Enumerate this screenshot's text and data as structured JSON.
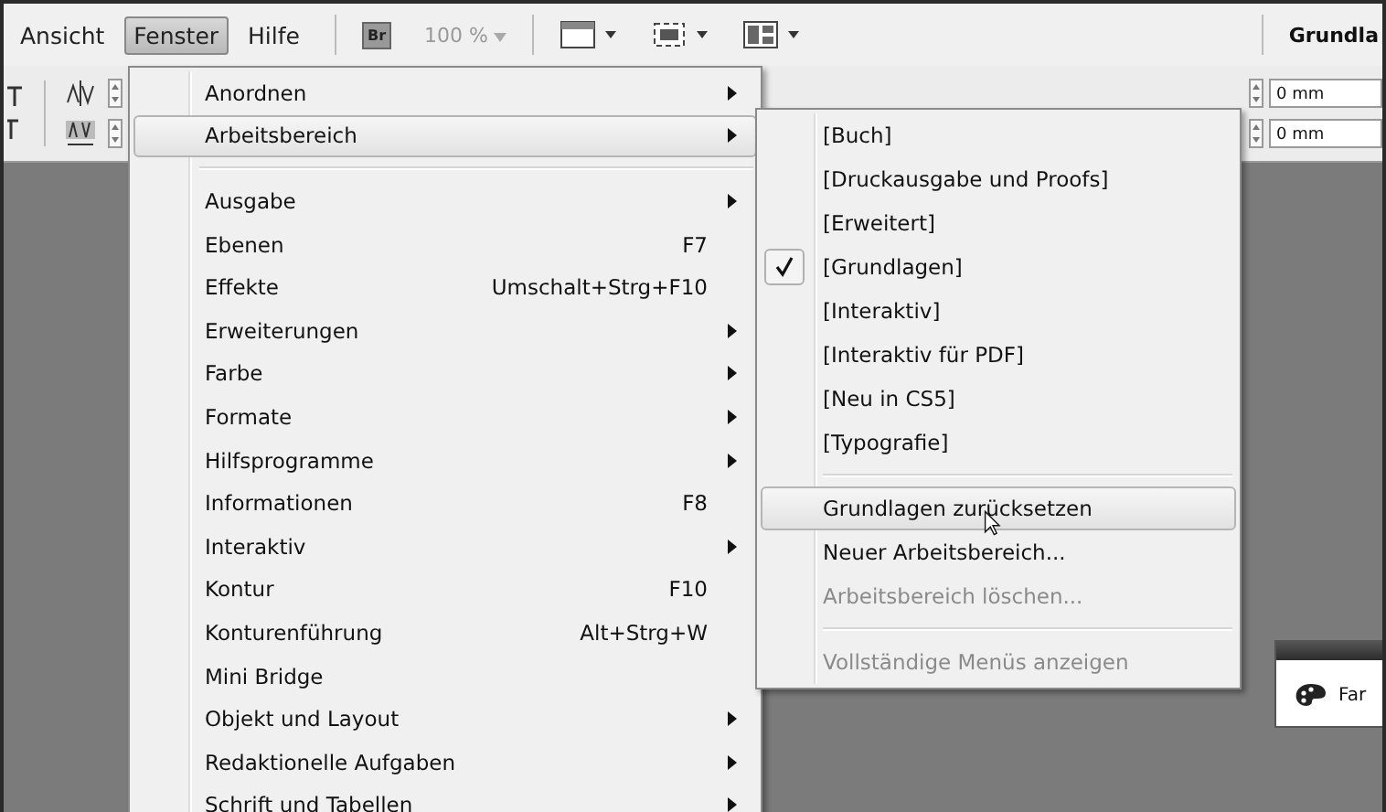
{
  "menubar": {
    "items": [
      {
        "label": "Ansicht",
        "selected": false
      },
      {
        "label": "Fenster",
        "selected": true
      },
      {
        "label": "Hilfe",
        "selected": false
      }
    ],
    "bridge": "Br",
    "zoom": "100 %",
    "workspace": "Grundla"
  },
  "control_panel": {
    "fields": [
      "0 mm",
      "0 mm"
    ]
  },
  "menu": [
    {
      "kind": "item",
      "label": "Anordnen",
      "submenu": true,
      "selected": false
    },
    {
      "kind": "item",
      "label": "Arbeitsbereich",
      "submenu": true,
      "selected": true
    },
    {
      "kind": "separator"
    },
    {
      "kind": "item",
      "label": "Ausgabe",
      "submenu": true,
      "selected": false
    },
    {
      "kind": "item",
      "label": "Ebenen",
      "shortcut": "F7",
      "submenu": false,
      "selected": false
    },
    {
      "kind": "item",
      "label": "Effekte",
      "shortcut": "Umschalt+Strg+F10",
      "submenu": false,
      "selected": false
    },
    {
      "kind": "item",
      "label": "Erweiterungen",
      "submenu": true,
      "selected": false
    },
    {
      "kind": "item",
      "label": "Farbe",
      "submenu": true,
      "selected": false
    },
    {
      "kind": "item",
      "label": "Formate",
      "submenu": true,
      "selected": false
    },
    {
      "kind": "item",
      "label": "Hilfsprogramme",
      "submenu": true,
      "selected": false
    },
    {
      "kind": "item",
      "label": "Informationen",
      "shortcut": "F8",
      "submenu": false,
      "selected": false
    },
    {
      "kind": "item",
      "label": "Interaktiv",
      "submenu": true,
      "selected": false
    },
    {
      "kind": "item",
      "label": "Kontur",
      "shortcut": "F10",
      "submenu": false,
      "selected": false
    },
    {
      "kind": "item",
      "label": "Konturenführung",
      "shortcut": "Alt+Strg+W",
      "submenu": false,
      "selected": false
    },
    {
      "kind": "item",
      "label": "Mini Bridge",
      "submenu": false,
      "selected": false
    },
    {
      "kind": "item",
      "label": "Objekt und Layout",
      "submenu": true,
      "selected": false
    },
    {
      "kind": "item",
      "label": "Redaktionelle Aufgaben",
      "submenu": true,
      "selected": false
    },
    {
      "kind": "item",
      "label": "Schrift und Tabellen",
      "submenu": true,
      "selected": false
    }
  ],
  "submenu": [
    {
      "kind": "item",
      "label": "[Buch]",
      "checked": false,
      "disabled": false,
      "selected": false
    },
    {
      "kind": "item",
      "label": "[Druckausgabe und Proofs]",
      "checked": false,
      "disabled": false,
      "selected": false
    },
    {
      "kind": "item",
      "label": "[Erweitert]",
      "checked": false,
      "disabled": false,
      "selected": false
    },
    {
      "kind": "item",
      "label": "[Grundlagen]",
      "checked": true,
      "disabled": false,
      "selected": false
    },
    {
      "kind": "item",
      "label": "[Interaktiv]",
      "checked": false,
      "disabled": false,
      "selected": false
    },
    {
      "kind": "item",
      "label": "[Interaktiv für PDF]",
      "checked": false,
      "disabled": false,
      "selected": false
    },
    {
      "kind": "item",
      "label": "[Neu in CS5]",
      "checked": false,
      "disabled": false,
      "selected": false
    },
    {
      "kind": "item",
      "label": "[Typografie]",
      "checked": false,
      "disabled": false,
      "selected": false
    },
    {
      "kind": "separator"
    },
    {
      "kind": "item",
      "label": "Grundlagen zurücksetzen",
      "checked": false,
      "disabled": false,
      "selected": true
    },
    {
      "kind": "item",
      "label": "Neuer Arbeitsbereich...",
      "checked": false,
      "disabled": false,
      "selected": false
    },
    {
      "kind": "item",
      "label": "Arbeitsbereich löschen...",
      "checked": false,
      "disabled": true,
      "selected": false
    },
    {
      "kind": "separator"
    },
    {
      "kind": "item",
      "label": "Vollständige Menüs anzeigen",
      "checked": false,
      "disabled": true,
      "selected": false
    }
  ],
  "panel": {
    "label": "Far"
  }
}
